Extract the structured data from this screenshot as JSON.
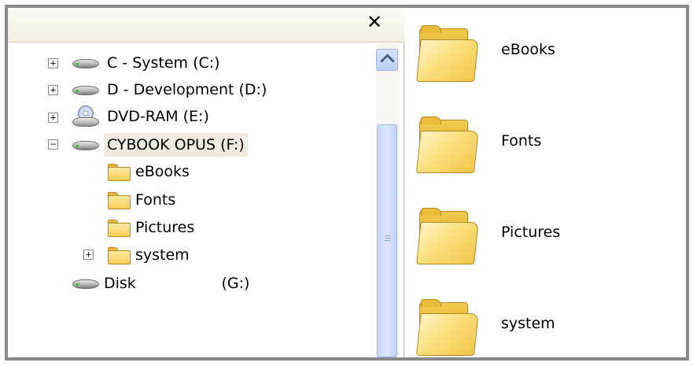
{
  "header": {
    "close_label": "✕"
  },
  "tree": {
    "drives": [
      {
        "label": "C - System (C:)",
        "icon": "drive-icon",
        "expander": "+"
      },
      {
        "label": "D - Development (D:)",
        "icon": "drive-icon",
        "expander": "+"
      },
      {
        "label": "DVD-RAM (E:)",
        "icon": "dvd-icon",
        "expander": "+"
      },
      {
        "label": "CYBOOK OPUS (F:)",
        "icon": "drive-icon",
        "expander": "−",
        "selected": true
      },
      {
        "label": "Disk                  (G:)",
        "icon": "drive-icon"
      }
    ],
    "folders": [
      {
        "label": "eBooks",
        "icon": "folder-icon"
      },
      {
        "label": "Fonts",
        "icon": "folder-icon"
      },
      {
        "label": "Pictures",
        "icon": "folder-icon"
      },
      {
        "label": "system",
        "icon": "folder-icon",
        "expander": "+"
      }
    ]
  },
  "files": [
    {
      "label": "eBooks",
      "icon": "folder-icon"
    },
    {
      "label": "Fonts",
      "icon": "folder-icon"
    },
    {
      "label": "Pictures",
      "icon": "folder-icon"
    },
    {
      "label": "system",
      "icon": "folder-icon"
    }
  ],
  "colors": {
    "frame_border": "#8a8a8a",
    "selection": "#eeebe0",
    "scrollbar_thumb": "#c6d6fb",
    "folder_yellow": "#f5cd58"
  }
}
